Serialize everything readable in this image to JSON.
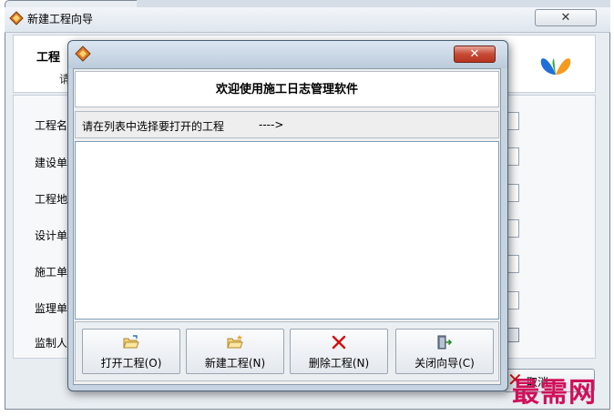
{
  "background_window": {
    "title": "新建工程向导",
    "close_glyph": "✕",
    "header": {
      "title": "工程",
      "subtitle": "请"
    },
    "field_labels": [
      "工程名",
      "建设单",
      "工程地",
      "设计单",
      "施工单",
      "监理单",
      "监制人"
    ],
    "cancel_label": "取消"
  },
  "dialog": {
    "close_glyph": "✕",
    "welcome": "欢迎使用施工日志管理软件",
    "hint": "请在列表中选择要打开的工程",
    "hint_arrow": "---->",
    "list_items": [],
    "buttons": [
      {
        "id": "open",
        "label": "打开工程(O)",
        "icon": "folder-open-icon"
      },
      {
        "id": "new",
        "label": "新建工程(N)",
        "icon": "folder-new-icon"
      },
      {
        "id": "delete",
        "label": "删除工程(N)",
        "icon": "delete-x-icon"
      },
      {
        "id": "close",
        "label": "关闭向导(C)",
        "icon": "exit-door-icon"
      }
    ]
  },
  "watermark": "最需网",
  "colors": {
    "accent_red": "#d01010",
    "watermark": "#d0105a",
    "dialog_frame": "#c6d4e2"
  }
}
